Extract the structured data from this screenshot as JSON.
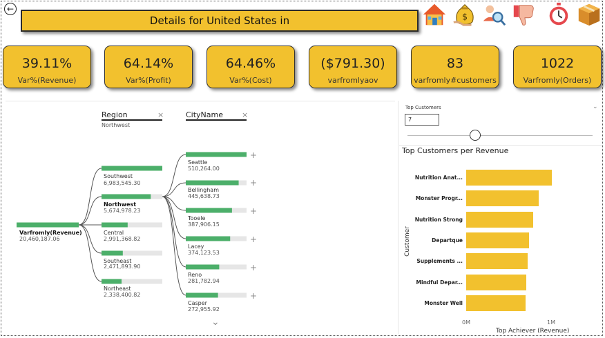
{
  "header": {
    "title": "Details for United States in",
    "nav_icons": [
      "home-icon",
      "money-bag-icon",
      "search-user-icon",
      "thumbs-down-icon",
      "stopwatch-icon",
      "package-icon"
    ],
    "back_glyph": "←"
  },
  "kpis": [
    {
      "value": "39.11%",
      "label": "Var%(Revenue)"
    },
    {
      "value": "64.14%",
      "label": "Var%(Profit)"
    },
    {
      "value": "64.46%",
      "label": "Var%(Cost)"
    },
    {
      "value": "($791.30)",
      "label": "varfromlyaov"
    },
    {
      "value": "83",
      "label": "varfromly#customers"
    },
    {
      "value": "1022",
      "label": "Varfromly(Orders)"
    }
  ],
  "tree": {
    "region_header": "Region",
    "region_selected": "Northwest",
    "city_header": "CityName",
    "close_glyph": "×",
    "plus_glyph": "+",
    "chevron_glyph": "⌄",
    "root": {
      "label": "Varfromly(Revenue)",
      "value": "20,460,187.06",
      "fill": 1.0
    },
    "regions": [
      {
        "label": "Southwest",
        "value": "6,983,545.30",
        "fill": 1.0
      },
      {
        "label": "Northwest",
        "value": "5,674,978.23",
        "fill": 0.81,
        "selected": true
      },
      {
        "label": "Central",
        "value": "2,991,368.82",
        "fill": 0.43
      },
      {
        "label": "Southeast",
        "value": "2,471,893.90",
        "fill": 0.35
      },
      {
        "label": "Northeast",
        "value": "2,338,400.82",
        "fill": 0.33
      }
    ],
    "cities": [
      {
        "label": "Seattle",
        "value": "510,264.00",
        "fill": 1.0
      },
      {
        "label": "Bellingham",
        "value": "445,638.73",
        "fill": 0.87
      },
      {
        "label": "Tooele",
        "value": "387,906.15",
        "fill": 0.76
      },
      {
        "label": "Lacey",
        "value": "374,123.53",
        "fill": 0.73
      },
      {
        "label": "Reno",
        "value": "281,782.94",
        "fill": 0.55
      },
      {
        "label": "Casper",
        "value": "272,955.92",
        "fill": 0.53
      }
    ],
    "colors": {
      "bar": "#4caf6a",
      "track": "#e6e6e6",
      "link": "#555555"
    }
  },
  "top_customers": {
    "title": "Top Customers",
    "input_value": "7",
    "slider_value": 7
  },
  "chart_data": {
    "type": "bar",
    "orientation": "horizontal",
    "title": "Top Customers per Revenue",
    "xlabel": "Top Achiever (Revenue)",
    "ylabel": "Customer",
    "categories": [
      "Nutrition Anat...",
      "Monster Progr...",
      "Nutrition Strong",
      "Departque",
      "Supplements ...",
      "Mindful Depar...",
      "Monster Well"
    ],
    "values": [
      1010000,
      850000,
      790000,
      740000,
      720000,
      710000,
      700000
    ],
    "xlim": [
      0,
      1000000
    ],
    "xticks": [
      "0M",
      "1M"
    ],
    "color": "#f2c12e",
    "grid": false,
    "legend": "none"
  }
}
